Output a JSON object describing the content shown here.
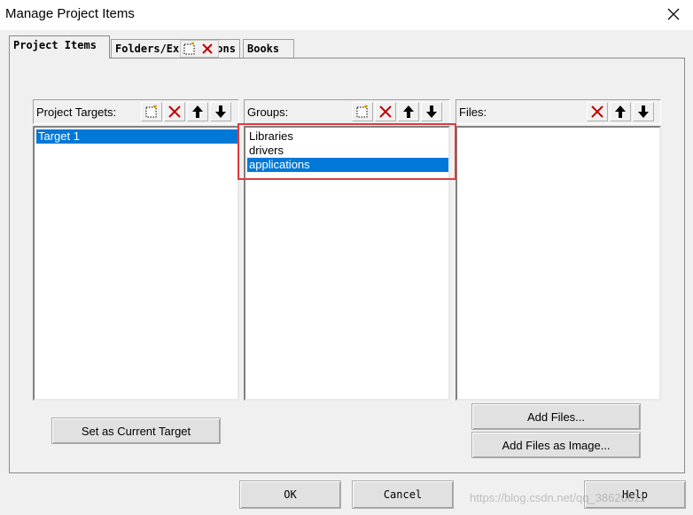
{
  "window": {
    "title": "Manage Project Items",
    "close_icon": "close-icon"
  },
  "tabs": [
    {
      "label": "Project Items",
      "active": true
    },
    {
      "label": "Folders/Extensions",
      "visible_text": "Folders/Ex",
      "trailing_text": "ons"
    },
    {
      "label": "Books"
    }
  ],
  "targets": {
    "header": "Project Targets:",
    "items": [
      {
        "label": "Target 1",
        "selected": true
      }
    ],
    "toolbar": [
      "new-icon",
      "delete-icon",
      "move-up-icon",
      "move-down-icon"
    ]
  },
  "groups": {
    "header": "Groups:",
    "items": [
      {
        "label": "Libraries",
        "selected": false
      },
      {
        "label": "drivers",
        "selected": false
      },
      {
        "label": "applications",
        "selected": true
      }
    ],
    "toolbar": [
      "new-icon",
      "delete-icon",
      "move-up-icon",
      "move-down-icon"
    ]
  },
  "files": {
    "header": "Files:",
    "items": [],
    "toolbar": [
      "delete-icon",
      "move-up-icon",
      "move-down-icon"
    ]
  },
  "buttons": {
    "set_current_target": "Set as Current Target",
    "add_files": "Add Files...",
    "add_files_image": "Add Files as Image...",
    "ok": "OK",
    "cancel": "Cancel",
    "help": "Help"
  },
  "watermark": "https://blog.csdn.net/qq_38620611",
  "colors": {
    "selection": "#0078d7",
    "highlight_box": "#e03a3a",
    "dialog_bg": "#f0f0f0"
  }
}
